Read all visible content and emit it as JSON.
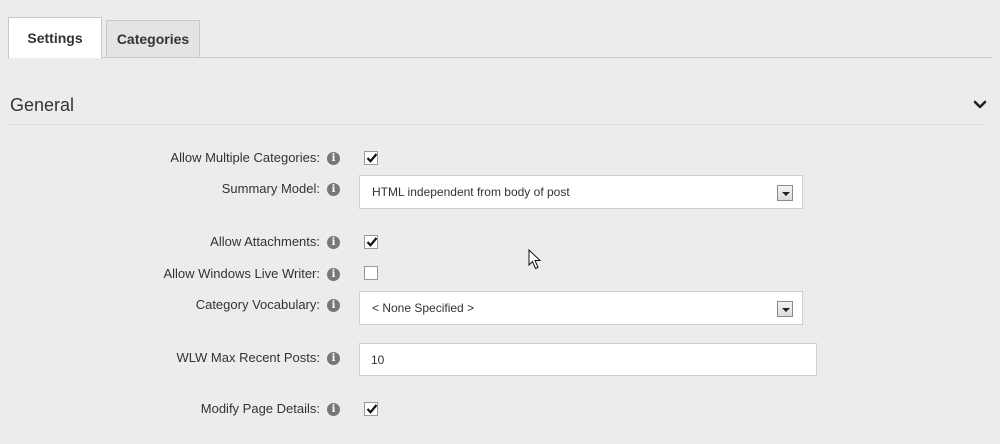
{
  "tabs": [
    {
      "label": "Settings",
      "active": true
    },
    {
      "label": "Categories",
      "active": false
    }
  ],
  "section": {
    "title": "General",
    "toggle_icon": "chevron-down-icon"
  },
  "fields": {
    "allow_multiple_categories": {
      "label": "Allow Multiple Categories:",
      "checked": true
    },
    "summary_model": {
      "label": "Summary Model:",
      "value": "HTML independent from body of post"
    },
    "allow_attachments": {
      "label": "Allow Attachments:",
      "checked": true
    },
    "allow_windows_live_writer": {
      "label": "Allow Windows Live Writer:",
      "checked": false
    },
    "category_vocabulary": {
      "label": "Category Vocabulary:",
      "value": "< None Specified >"
    },
    "wlw_max_recent_posts": {
      "label": "WLW Max Recent Posts:",
      "value": "10"
    },
    "modify_page_details": {
      "label": "Modify Page Details:",
      "checked": true
    }
  },
  "info_icon": "info-icon",
  "colors": {
    "background": "#ececec",
    "tab_active": "#ffffff",
    "tab_inactive": "#e4e4e4",
    "border": "#c8c8c8"
  }
}
